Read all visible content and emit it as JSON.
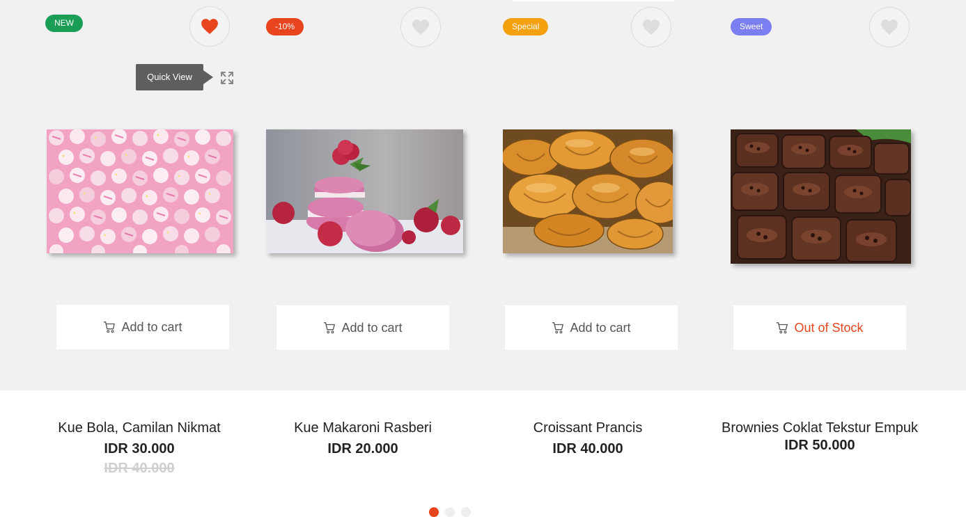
{
  "quick_view": {
    "label": "Quick View"
  },
  "products": [
    {
      "badge": "NEW",
      "badge_color": "#1a9e55",
      "favorited": true,
      "image": "pink-cake-balls-photo",
      "button": "Add to cart",
      "button_state": "available",
      "name": "Kue Bola, Camilan Nikmat",
      "price": "IDR 30.000",
      "old_price": "IDR 40.000"
    },
    {
      "badge": "-10%",
      "badge_color": "#e8451e",
      "favorited": false,
      "image": "raspberry-macarons-photo",
      "button": "Add to cart",
      "button_state": "available",
      "name": "Kue Makaroni Rasberi",
      "price": "IDR 20.000"
    },
    {
      "badge": "Special",
      "badge_color": "#f5a00f",
      "favorited": false,
      "image": "croissants-photo",
      "button": "Add to cart",
      "button_state": "available",
      "name": "Croissant Prancis",
      "price": "IDR 40.000"
    },
    {
      "badge": "Sweet",
      "badge_color": "#7b7ef0",
      "favorited": false,
      "image": "chocolate-brownies-photo",
      "button": "Out of Stock",
      "button_state": "out_of_stock",
      "name": "Brownies Coklat Tekstur Empuk",
      "price": "IDR 50.000"
    }
  ],
  "carousel": {
    "pages": 3,
    "active_page": 1
  },
  "colors": {
    "accent": "#e8451e",
    "heart_inactive": "#dddddd",
    "panel_bg": "#f1f1f1"
  }
}
